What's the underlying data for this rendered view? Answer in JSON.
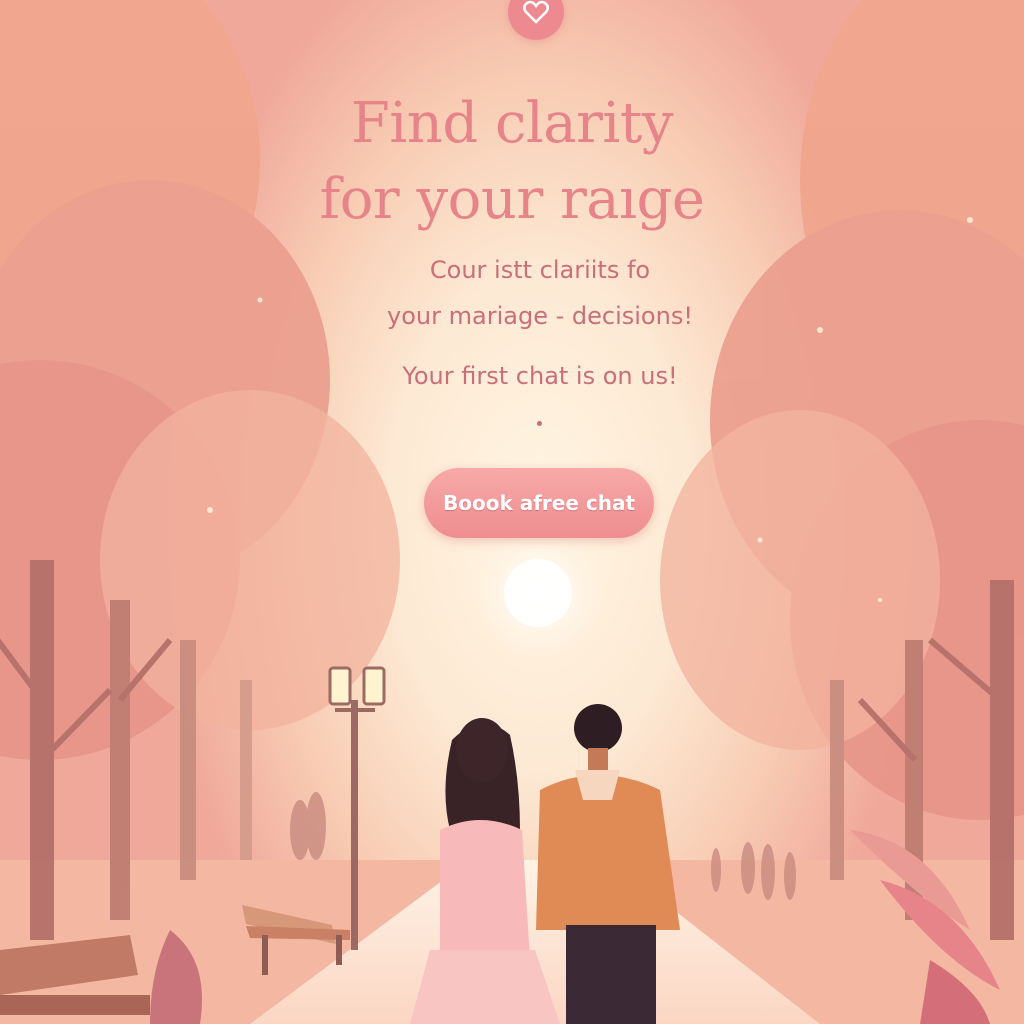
{
  "header": {
    "logo_icon": "heart-icon",
    "accent_color": "#ec8a8f"
  },
  "hero": {
    "headline_line1": "Find clarity",
    "headline_line2": "for your raıge",
    "subtitle_line1": "Cour istt clariits fo",
    "subtitle_line2": "your mariage  - decisions!",
    "promo": "Your first  chat is on us!",
    "cta_label": "Boook afree chat",
    "headline_color": "#e7848a",
    "text_color": "#c96f7a",
    "button_color": "#ef8d90"
  },
  "scene": {
    "illustration": "couple-walking-in-autumn-park",
    "palette": [
      "#fff6e2",
      "#f8cdb4",
      "#f0a89a",
      "#d98a7c",
      "#a8615f"
    ]
  }
}
